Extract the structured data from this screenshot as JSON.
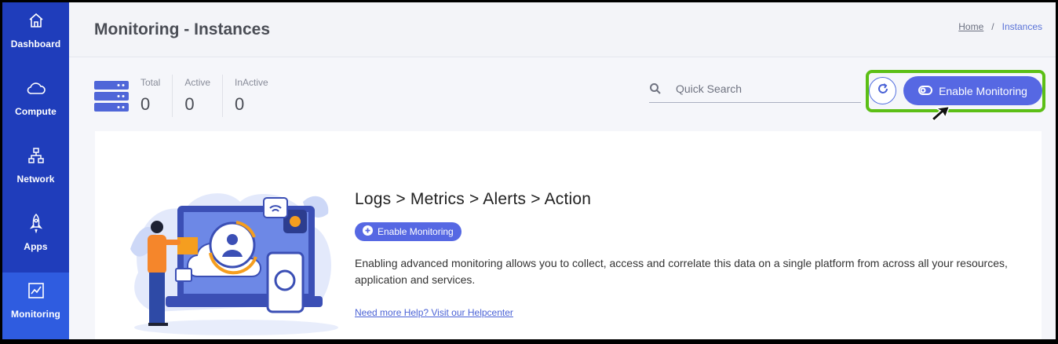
{
  "sidebar": {
    "items": [
      {
        "label": "Dashboard",
        "icon": "home-icon"
      },
      {
        "label": "Compute",
        "icon": "cloud-icon"
      },
      {
        "label": "Network",
        "icon": "network-icon"
      },
      {
        "label": "Apps",
        "icon": "rocket-icon"
      },
      {
        "label": "Monitoring",
        "icon": "chart-icon",
        "active": true
      }
    ]
  },
  "header": {
    "title": "Monitoring - Instances",
    "breadcrumb": {
      "home": "Home",
      "separator": "/",
      "current": "Instances"
    }
  },
  "stats": [
    {
      "label": "Total",
      "value": "0"
    },
    {
      "label": "Active",
      "value": "0"
    },
    {
      "label": "InActive",
      "value": "0"
    }
  ],
  "search": {
    "placeholder": "Quick Search",
    "value": ""
  },
  "toolbar": {
    "enable_label": "Enable Monitoring",
    "refresh_icon": "refresh-icon",
    "highlight_color": "#5cbf16"
  },
  "empty_state": {
    "heading": "Logs > Metrics > Alerts > Action",
    "button_label": "Enable Monitoring",
    "description": "Enabling advanced monitoring allows you to collect, access and correlate this data on a single platform from across all your resources, application and services.",
    "help_link": "Need more Help? Visit our Helpcenter"
  },
  "colors": {
    "sidebar": "#1f3dbb",
    "sidebar_active": "#2f5ce0",
    "accent": "#5668e3"
  }
}
